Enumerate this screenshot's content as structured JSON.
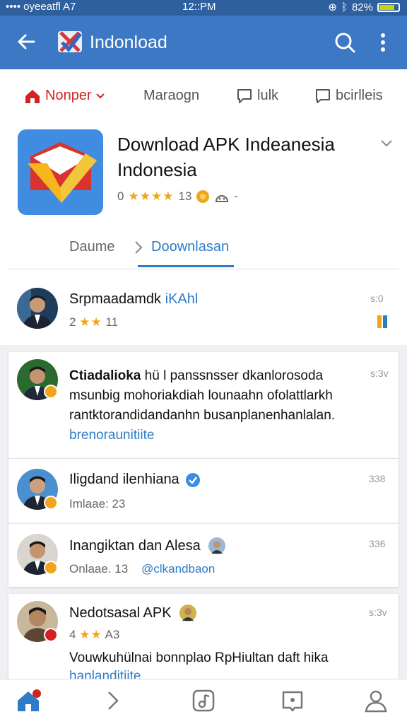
{
  "status": {
    "carrier": "•••• oyeeatfl A7",
    "time": "12::PM",
    "battery": "82%",
    "battery_level": 0.82
  },
  "appbar": {
    "title": "Indonload"
  },
  "nav": {
    "tabs": [
      "Nonper",
      "Maraogn",
      "lulk",
      "bcirlleis"
    ]
  },
  "app": {
    "title_line1": "Download APK Indeanesia",
    "title_line2": "Indonesia",
    "rating": "0",
    "stars": "★★★★",
    "count": "13"
  },
  "subtabs": {
    "left": "Daume",
    "right": "Doownlasan"
  },
  "feed": [
    {
      "name": "Srpmaadamdk",
      "name_accent": "iKAhl",
      "stars_count": "2",
      "stars": "★★",
      "meta": "11",
      "time": "s:0"
    },
    {
      "name": "Ctiadalioka",
      "text1": "hü l panssnsser dkanlorosoda",
      "text2": "msunbig mohoriakdiah lounaahn ofolattlarkh",
      "text3": "rantktorandidandanhn busanplanenhanlalan.",
      "link": "brenoraunitiite",
      "time": "s:3v"
    },
    {
      "name": "Iligdand ilenhiana",
      "sub": "Imlaae: 23",
      "time": "338"
    },
    {
      "name": "Inangiktan dan Alesa",
      "sub": "Onlaae. 13",
      "link": "@clkandbaon",
      "time": "336"
    },
    {
      "name": "Nedotsasal APK",
      "stars_count": "4",
      "stars": "★★",
      "meta": "A3",
      "text": "Vouwkuhülnai bonnplao RpHiultan daft hika",
      "link": "hanlanditiite",
      "time": "s:3v"
    }
  ],
  "colors": {
    "appbar": "#3d78c4",
    "accent_red": "#d32222",
    "accent_blue": "#2e7bc8",
    "star": "#f2a51a"
  }
}
